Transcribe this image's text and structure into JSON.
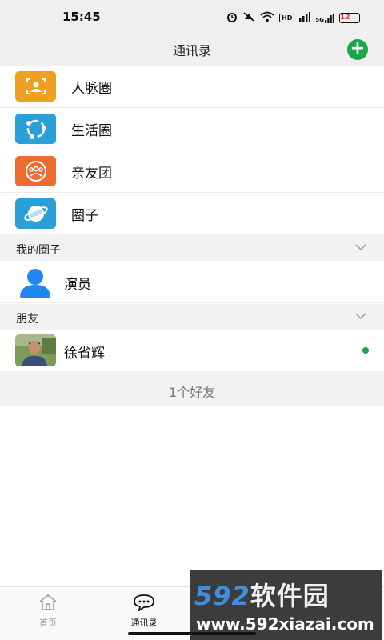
{
  "status_bar": {
    "time": "15:45",
    "signal_label": "5G",
    "hd_label": "HD",
    "battery": "12"
  },
  "header": {
    "title": "通讯录",
    "add_symbol": "+"
  },
  "menu_items": [
    {
      "label": "人脉圈",
      "icon": "contact-card-icon",
      "color": "#f0a020"
    },
    {
      "label": "生活圈",
      "icon": "share-circle-icon",
      "color": "#2a9fd8"
    },
    {
      "label": "亲友团",
      "icon": "group-icon",
      "color": "#ee6b32"
    },
    {
      "label": "圈子",
      "icon": "planet-icon",
      "color": "#2a9fd8"
    }
  ],
  "my_circles": {
    "title": "我的圈子",
    "items": [
      {
        "name": "演员",
        "avatar": "person-icon",
        "color": "#1e88f0"
      }
    ]
  },
  "friends": {
    "title": "朋友",
    "items": [
      {
        "name": "徐省辉",
        "avatar": "photo-avatar",
        "online": true
      }
    ],
    "count_text": "1个好友"
  },
  "tabs": [
    {
      "label": "首页",
      "icon": "home-icon",
      "active": false
    },
    {
      "label": "通讯录",
      "icon": "chat-bubble-icon",
      "active": true
    }
  ],
  "watermark": {
    "brand_num": "592",
    "brand_cn": "软件园",
    "url": "www.592xiazai.com"
  },
  "colors": {
    "accent_green": "#1aa64a",
    "header_bg": "#efefef",
    "section_bg": "#f2f2f2"
  }
}
